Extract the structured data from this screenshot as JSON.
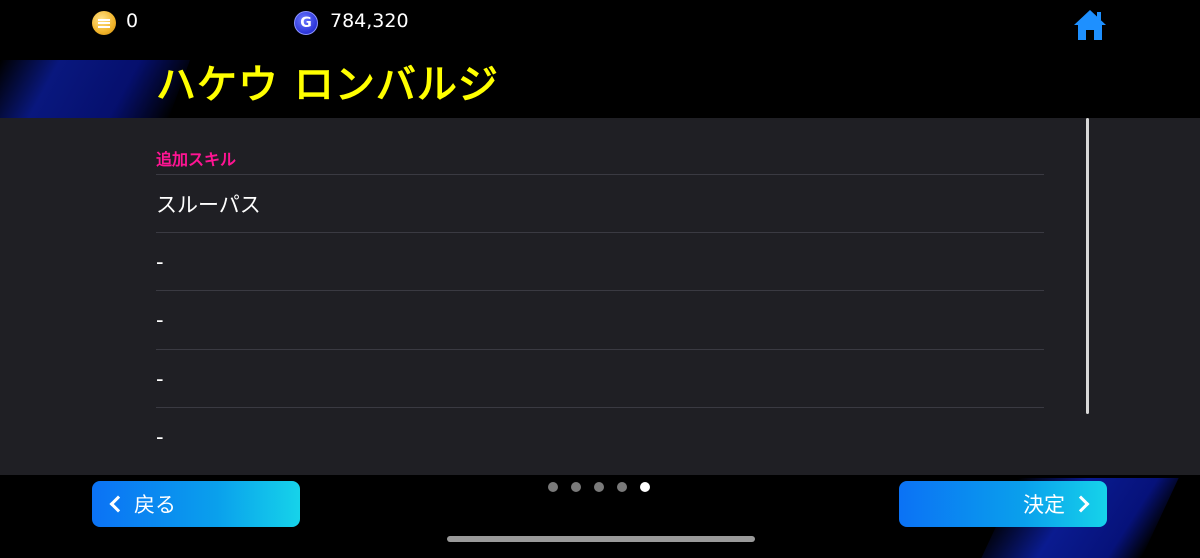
{
  "currency": {
    "coins": "0",
    "gp": "784,320",
    "gp_symbol": "G"
  },
  "header": {
    "player_name": "ハケウ ロンバルジ"
  },
  "skills": {
    "section_label": "追加スキル",
    "items": [
      {
        "label": "スルーパス"
      },
      {
        "label": "-"
      },
      {
        "label": "-"
      },
      {
        "label": "-"
      },
      {
        "label": "-"
      }
    ]
  },
  "pagination": {
    "total": 5,
    "current": 5
  },
  "footer": {
    "back_label": "戻る",
    "confirm_label": "決定"
  },
  "colors": {
    "title": "#ffff00",
    "section_label": "#ff1493",
    "button_start": "#0b72f5",
    "button_end": "#16d3ea",
    "panel": "#1f1f24"
  }
}
